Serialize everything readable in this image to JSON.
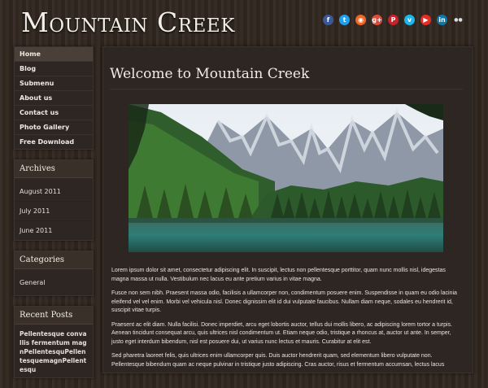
{
  "site": {
    "title": "Mountain Creek"
  },
  "social_icons": [
    {
      "name": "facebook-icon",
      "glyph": "f",
      "color": "#3b5998"
    },
    {
      "name": "twitter-icon",
      "glyph": "t",
      "color": "#1da1f2"
    },
    {
      "name": "rss-icon",
      "glyph": "◉",
      "color": "#f26522"
    },
    {
      "name": "google-plus-icon",
      "glyph": "g+",
      "color": "#dd4b39"
    },
    {
      "name": "pinterest-icon",
      "glyph": "P",
      "color": "#cb2027"
    },
    {
      "name": "vimeo-icon",
      "glyph": "v",
      "color": "#1ab7ea"
    },
    {
      "name": "youtube-icon",
      "glyph": "▶",
      "color": "#e52d27"
    },
    {
      "name": "linkedin-icon",
      "glyph": "in",
      "color": "#0e76a8"
    },
    {
      "name": "flickr-icon",
      "glyph": "●●",
      "color": "transparent"
    }
  ],
  "nav": {
    "items": [
      {
        "label": "Home"
      },
      {
        "label": "Blog"
      },
      {
        "label": "Submenu"
      },
      {
        "label": "About us"
      },
      {
        "label": "Contact us"
      },
      {
        "label": "Photo Gallery"
      },
      {
        "label": "Free Download"
      }
    ]
  },
  "archives": {
    "title": "Archives",
    "items": [
      "August 2011",
      "July 2011",
      "June 2011"
    ]
  },
  "categories": {
    "title": "Categories",
    "items": [
      "General"
    ]
  },
  "recent_posts": {
    "title": "Recent Posts",
    "items": [
      "Pellentesque convallis fermentum magnPellentesquPellentesquemagnPellentesqu"
    ]
  },
  "main": {
    "title": "Welcome to Mountain Creek",
    "paragraphs": [
      "Lorem ipsum dolor sit amet, consectetur adipiscing elit. In suscipit, lectus non pellentesque porttitor, quam nunc mollis nisl, idegestas magna massa ut nulla. Vestibulum nec lacus eu ante pretium varius in vitae magna.",
      "Fusce non sem nibh. Praesent massa odio, facilisis a ullamcorper non, condimentum posuere enim. Suspendisse in quam eu odio lacinia eleifend vel vel enim. Morbi vel vehicula nisl. Donec dignissim elit id dui vulputate faucibus. Nullam diam neque, sodales eu hendrerit id, suscipit vitae turpis.",
      "Praesent ac elit diam. Nulla facilisi. Donec imperdiet, arcu eget lobortis auctor, tellus dui mollis libero, ac adipiscing lorem tortor a turpis. Aenean tincidunt consequat arcu, quis ultrices nisl condimentum ut. Etiam neque odio, tristique a rhoncus at, auctor ut ante. In semper, justo eget interdum bibendum, nisl est posuere dui, ut varius nunc lectus et mauris. Curabitur at elit est.",
      "Sed pharetra laoreet felis, quis ultrices enim ullamcorper quis. Duis auctor hendrerit quam, sed elementum libero vulputate non. Pellentesque bibendum quam ac neque pulvinar in tristique justo adipiscing. Cras auctor, risus et fermentum accumsan, lectus lacus"
    ]
  }
}
